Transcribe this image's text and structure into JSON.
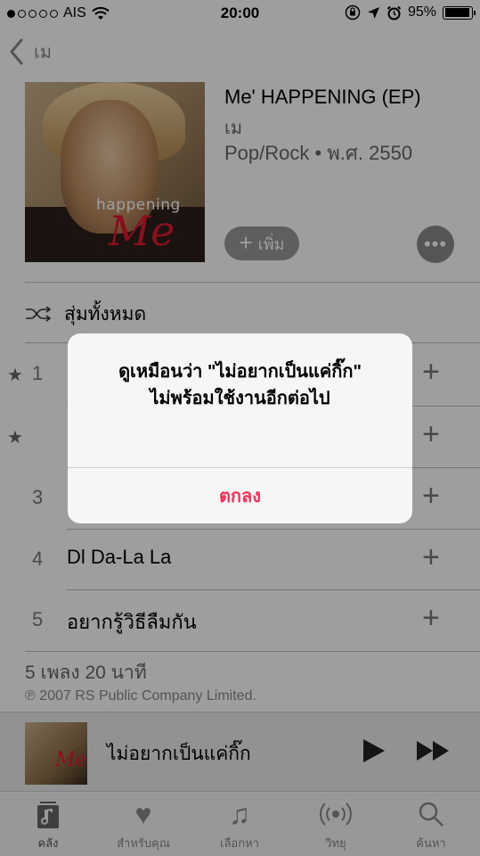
{
  "status_bar": {
    "carrier": "AIS",
    "time": "20:00",
    "battery_percent": "95%",
    "battery_level": 0.95,
    "signal_bars_filled": 1,
    "signal_bars_total": 5
  },
  "nav": {
    "back_label": "เม"
  },
  "album": {
    "title": "Me' HAPPENING (EP)",
    "artist": "เม",
    "meta": "Pop/Rock • พ.ศ. 2550",
    "art_text_small": "happening",
    "art_text_large": "Me"
  },
  "actions": {
    "add_label": "เพิ่ม",
    "more_label": "•••"
  },
  "shuffle": {
    "label": "สุ่มทั้งหมด"
  },
  "tracks": [
    {
      "number": "1",
      "title": "",
      "starred": true
    },
    {
      "number": "",
      "title": "",
      "starred": true
    },
    {
      "number": "3",
      "title": "",
      "starred": false
    },
    {
      "number": "4",
      "title": "Dl Da-La La",
      "starred": false
    },
    {
      "number": "5",
      "title": "อยากรู้วิธีลืมกัน",
      "starred": false
    }
  ],
  "summary": "5 เพลง 20 นาที",
  "copyright": "℗ 2007 RS Public Company Limited.",
  "mini_player": {
    "title": "ไม่อยากเป็นแค่กิ๊ก"
  },
  "tabs": [
    {
      "label": "คลัง",
      "icon": "library-icon"
    },
    {
      "label": "สำหรับคุณ",
      "icon": "heart-icon"
    },
    {
      "label": "เลือกหา",
      "icon": "music-note-icon"
    },
    {
      "label": "วิทยุ",
      "icon": "radio-icon"
    },
    {
      "label": "ค้นหา",
      "icon": "search-icon"
    }
  ],
  "alert": {
    "line1": "ดูเหมือนว่า \"ไม่อยากเป็นแค่กิ๊ก\"",
    "line2": "ไม่พร้อมใช้งานอีกต่อไป",
    "ok_label": "ตกลง"
  },
  "colors": {
    "alert_button": "#ff2d55",
    "album_art_accent": "#e0182f"
  }
}
